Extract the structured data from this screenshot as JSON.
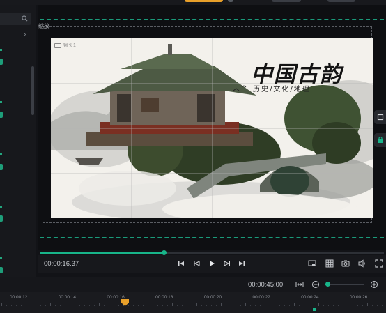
{
  "preview": {
    "corner_label": "缩放",
    "camera_label": "镜头1",
    "title": "中国古韵",
    "subtitle": "历史/文化/地理"
  },
  "player": {
    "current_time": "00:00:16.37",
    "progress_percent": 36
  },
  "timeline": {
    "total_time": "00:00:45:00",
    "zoom_percent": 5,
    "ruler_labels": [
      "00:00:12",
      "00:00:14",
      "00:00:16",
      "00:00:18",
      "00:00:20",
      "00:00:22",
      "00:00:24",
      "00:00:26"
    ],
    "playhead_label": "00:00:16"
  },
  "icons": {
    "search": "search-icon",
    "expand": "chevron-right-icon",
    "prev_clip": "skip-back-icon",
    "prev_frame": "step-back-icon",
    "play": "play-icon",
    "next_frame": "step-forward-icon",
    "next_clip": "skip-forward-icon",
    "display": "display-icon",
    "grid": "grid-icon",
    "snapshot": "camera-icon",
    "volume": "volume-icon",
    "fullscreen": "fullscreen-icon",
    "fit": "fit-icon",
    "zoom_out": "zoom-out-icon",
    "zoom_in": "zoom-in-icon"
  },
  "colors": {
    "accent": "#18b58a",
    "playhead": "#e8a02a",
    "background": "#121317"
  }
}
